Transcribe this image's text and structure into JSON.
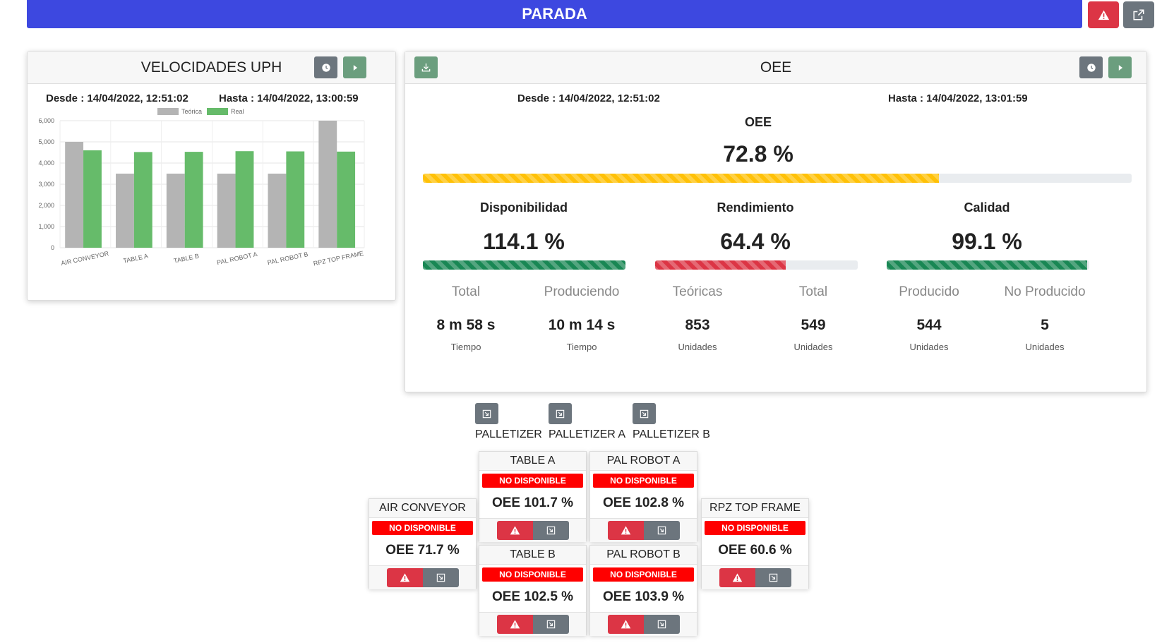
{
  "status": {
    "label": "PARADA",
    "colors": {
      "bar": "#3d48e0",
      "alert": "#dc3545",
      "secondary": "#6c757d"
    }
  },
  "top_actions": {
    "alert_icon": "warning-icon",
    "external_icon": "external-link-icon"
  },
  "uph": {
    "title": "VELOCIDADES UPH",
    "desde": "Desde : 14/04/2022, 12:51:02",
    "hasta": "Hasta : 14/04/2022, 13:00:59",
    "icons": [
      "clock-icon",
      "play-icon"
    ]
  },
  "chart_data": {
    "type": "bar",
    "categories": [
      "AIR CONVEYOR",
      "TABLE A",
      "TABLE B",
      "PAL ROBOT A",
      "PAL ROBOT  B",
      "RPZ TOP FRAME"
    ],
    "series": [
      {
        "name": "Teórica",
        "values": [
          5000,
          3500,
          3500,
          3500,
          3500,
          6000
        ],
        "color": "#b4b4b4"
      },
      {
        "name": "Real",
        "values": [
          4600,
          4520,
          4530,
          4560,
          4550,
          4540
        ],
        "color": "#66bb6a"
      }
    ],
    "ylim": [
      0,
      6000
    ],
    "yticks": [
      "0",
      "1,000",
      "2,000",
      "3,000",
      "4,000",
      "5,000",
      "6,000"
    ],
    "grid": true,
    "legend": "top"
  },
  "oee": {
    "title": "OEE",
    "desde": "Desde : 14/04/2022, 12:51:02",
    "hasta": "Hasta : 14/04/2022, 13:01:59",
    "label": "OEE",
    "value": "72.8 %",
    "progress": 72.8,
    "icons": [
      "download-icon",
      "clock-icon",
      "play-icon"
    ],
    "metrics": [
      {
        "label": "Disponibilidad",
        "value": "114.1 %",
        "progress": 100,
        "color": "green",
        "subs": [
          {
            "head": "Total",
            "value": "8 m 58 s",
            "unit": "Tiempo"
          },
          {
            "head": "Produciendo",
            "value": "10 m 14 s",
            "unit": "Tiempo"
          }
        ]
      },
      {
        "label": "Rendimiento",
        "value": "64.4 %",
        "progress": 64.4,
        "color": "red",
        "subs": [
          {
            "head": "Teóricas",
            "value": "853",
            "unit": "Unidades"
          },
          {
            "head": "Total",
            "value": "549",
            "unit": "Unidades"
          }
        ]
      },
      {
        "label": "Calidad",
        "value": "99.1 %",
        "progress": 99.1,
        "color": "green",
        "subs": [
          {
            "head": "Producido",
            "value": "544",
            "unit": "Unidades"
          },
          {
            "head": "No Producido",
            "value": "5",
            "unit": "Unidades"
          }
        ]
      }
    ]
  },
  "groups": [
    {
      "label": "PALLETIZER",
      "icon": "exit-icon"
    },
    {
      "label": "PALLETIZER A",
      "icon": "exit-icon"
    },
    {
      "label": "PALLETIZER B",
      "icon": "exit-icon"
    }
  ],
  "machines": [
    {
      "name": "TABLE A",
      "status": "NO DISPONIBLE",
      "oee": "OEE 101.7 %"
    },
    {
      "name": "PAL ROBOT A",
      "status": "NO DISPONIBLE",
      "oee": "OEE 102.8 %"
    },
    {
      "name": "AIR CONVEYOR",
      "status": "NO DISPONIBLE",
      "oee": "OEE 71.7 %"
    },
    {
      "name": "RPZ TOP FRAME",
      "status": "NO DISPONIBLE",
      "oee": "OEE 60.6 %"
    },
    {
      "name": "TABLE B",
      "status": "NO DISPONIBLE",
      "oee": "OEE 102.5 %"
    },
    {
      "name": "PAL ROBOT B",
      "status": "NO DISPONIBLE",
      "oee": "OEE 103.9 %"
    }
  ]
}
